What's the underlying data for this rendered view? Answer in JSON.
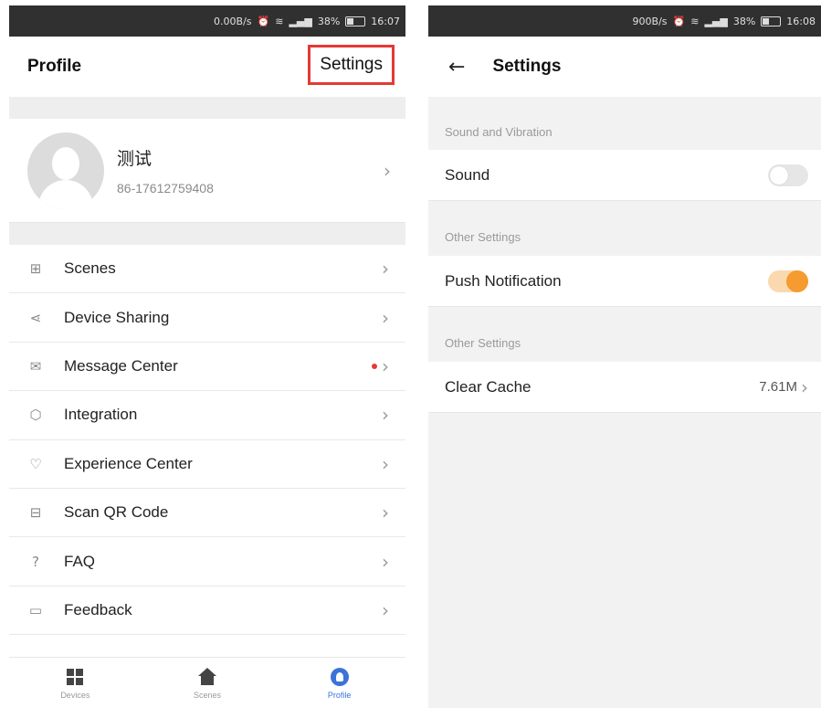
{
  "left": {
    "status": {
      "speed": "0.00B/s",
      "battery": "38%",
      "time": "16:07"
    },
    "header": {
      "title": "Profile",
      "settings_label": "Settings"
    },
    "profile": {
      "name": "测试",
      "phone": "86-17612759408"
    },
    "menu": [
      {
        "label": "Scenes",
        "icon": "scenes-icon",
        "glyph": "⊞"
      },
      {
        "label": "Device Sharing",
        "icon": "share-icon",
        "glyph": "⋖"
      },
      {
        "label": "Message Center",
        "icon": "envelope-icon",
        "glyph": "✉",
        "unread": true
      },
      {
        "label": "Integration",
        "icon": "cube-icon",
        "glyph": "⬡"
      },
      {
        "label": "Experience Center",
        "icon": "heart-icon",
        "glyph": "♡"
      },
      {
        "label": "Scan QR Code",
        "icon": "scan-icon",
        "glyph": "⊟"
      },
      {
        "label": "FAQ",
        "icon": "question-icon",
        "glyph": "?"
      },
      {
        "label": "Feedback",
        "icon": "feedback-icon",
        "glyph": "▭"
      }
    ],
    "tabs": [
      {
        "label": "Devices",
        "icon": "devices-icon"
      },
      {
        "label": "Scenes",
        "icon": "home-icon"
      },
      {
        "label": "Profile",
        "icon": "profile-icon",
        "active": true
      }
    ]
  },
  "right": {
    "status": {
      "speed": "900B/s",
      "battery": "38%",
      "time": "16:08"
    },
    "header": {
      "title": "Settings"
    },
    "groups": [
      {
        "label": "Sound and Vibration",
        "row": {
          "label": "Sound",
          "type": "toggle",
          "on": false
        }
      },
      {
        "label": "Other Settings",
        "row": {
          "label": "Push Notification",
          "type": "toggle",
          "on": true
        }
      },
      {
        "label": "Other Settings",
        "row": {
          "label": "Clear Cache",
          "type": "value",
          "value": "7.61M"
        }
      }
    ]
  },
  "colors": {
    "accent_orange": "#f59b30",
    "accent_blue": "#3b73d8",
    "highlight_red": "#e53935"
  }
}
